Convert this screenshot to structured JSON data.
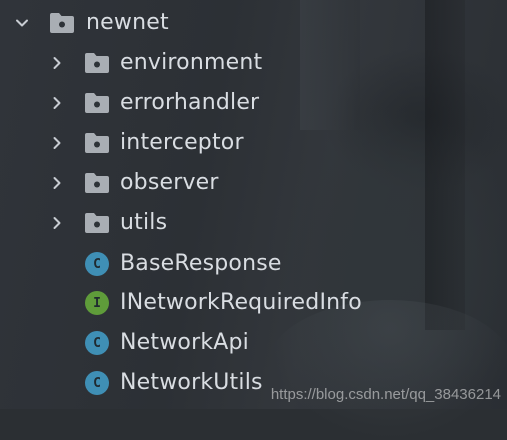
{
  "tree": {
    "root": {
      "label": "newnet",
      "icon": "folder-package-icon",
      "expanded": true
    },
    "folders": [
      {
        "label": "environment",
        "icon": "folder-package-icon"
      },
      {
        "label": "errorhandler",
        "icon": "folder-package-icon"
      },
      {
        "label": "interceptor",
        "icon": "folder-package-icon"
      },
      {
        "label": "observer",
        "icon": "folder-package-icon"
      },
      {
        "label": "utils",
        "icon": "folder-package-icon"
      }
    ],
    "files": [
      {
        "label": "BaseResponse",
        "icon": "class-icon",
        "badge": "C"
      },
      {
        "label": "INetworkRequiredInfo",
        "icon": "interface-icon",
        "badge": "I"
      },
      {
        "label": "NetworkApi",
        "icon": "class-icon",
        "badge": "C"
      },
      {
        "label": "NetworkUtils",
        "icon": "class-icon",
        "badge": "C"
      }
    ]
  },
  "watermark": "https://blog.csdn.net/qq_38436214",
  "colors": {
    "class_badge": "#3f8fb5",
    "interface_badge": "#5f9c3a",
    "folder": "#a9aeb4",
    "text": "#d9dde2"
  }
}
